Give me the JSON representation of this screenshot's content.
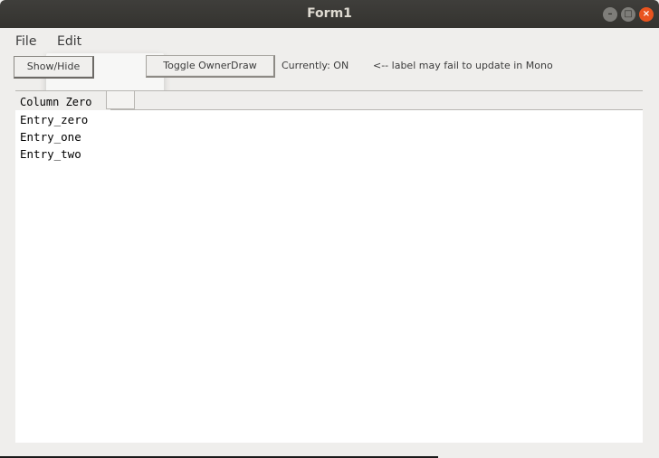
{
  "window": {
    "title": "Form1",
    "buttons": {
      "minimize": "–",
      "maximize": "□",
      "close": "×"
    }
  },
  "menubar": {
    "items": [
      "File",
      "Edit"
    ]
  },
  "toolbar": {
    "show_hide_label": "Show/Hide",
    "toggle_label": "Toggle OwnerDraw",
    "status_label": "Currently: ON",
    "note_label": "<-- label may fail to update in Mono"
  },
  "listview": {
    "columns": [
      "Column Zero",
      ""
    ],
    "rows": [
      "Entry_zero",
      "Entry_one",
      "Entry_two"
    ]
  },
  "colors": {
    "titlebar": "#3a3935",
    "close_button": "#e9541f",
    "background": "#efeeec"
  }
}
